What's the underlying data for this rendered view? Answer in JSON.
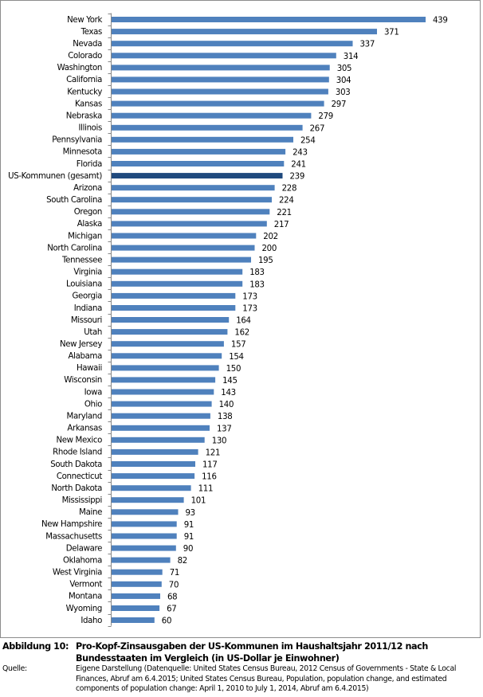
{
  "chart_data": {
    "type": "bar",
    "orientation": "horizontal",
    "title": "",
    "xlabel": "",
    "ylabel": "",
    "xlim": [
      0,
      439
    ],
    "grid": false,
    "legend": "none",
    "categories": [
      "New York",
      "Texas",
      "Nevada",
      "Colorado",
      "Washington",
      "California",
      "Kentucky",
      "Kansas",
      "Nebraska",
      "Illinois",
      "Pennsylvania",
      "Minnesota",
      "Florida",
      "US-Kommunen (gesamt)",
      "Arizona",
      "South Carolina",
      "Oregon",
      "Alaska",
      "Michigan",
      "North Carolina",
      "Tennessee",
      "Virginia",
      "Louisiana",
      "Georgia",
      "Indiana",
      "Missouri",
      "Utah",
      "New Jersey",
      "Alabama",
      "Hawaii",
      "Wisconsin",
      "Iowa",
      "Ohio",
      "Maryland",
      "Arkansas",
      "New Mexico",
      "Rhode Island",
      "South Dakota",
      "Connecticut",
      "North Dakota",
      "Mississippi",
      "Maine",
      "New Hampshire",
      "Massachusetts",
      "Delaware",
      "Oklahoma",
      "West Virginia",
      "Vermont",
      "Montana",
      "Wyoming",
      "Idaho"
    ],
    "values": [
      439,
      371,
      337,
      314,
      305,
      304,
      303,
      297,
      279,
      267,
      254,
      243,
      241,
      239,
      228,
      224,
      221,
      217,
      202,
      200,
      195,
      183,
      183,
      173,
      173,
      164,
      162,
      157,
      154,
      150,
      145,
      143,
      140,
      138,
      137,
      130,
      121,
      117,
      116,
      111,
      101,
      93,
      91,
      91,
      90,
      82,
      71,
      70,
      68,
      67,
      60
    ],
    "highlight_category": "US-Kommunen (gesamt)",
    "colors": {
      "bar": "#4f81bd",
      "highlight": "#1f497d",
      "axis": "#868686"
    }
  },
  "caption": {
    "figure_key": "Abbildung 10:",
    "figure_title": "Pro-Kopf-Zinsausgaben der US-Kommunen im Haushaltsjahr 2011/12 nach Bundesstaaten im Vergleich (in US-Dollar je Einwohner)",
    "source_key": "Quelle:",
    "source_text": "Eigene Darstellung (Datenquelle: United States Census Bureau, 2012 Census of Governments - State & Local Finances, Abruf am 6.4.2015; United States Census Bureau, Population, population change, and estimated components of population change: April 1, 2010 to July 1, 2014, Abruf am 6.4.2015)"
  }
}
